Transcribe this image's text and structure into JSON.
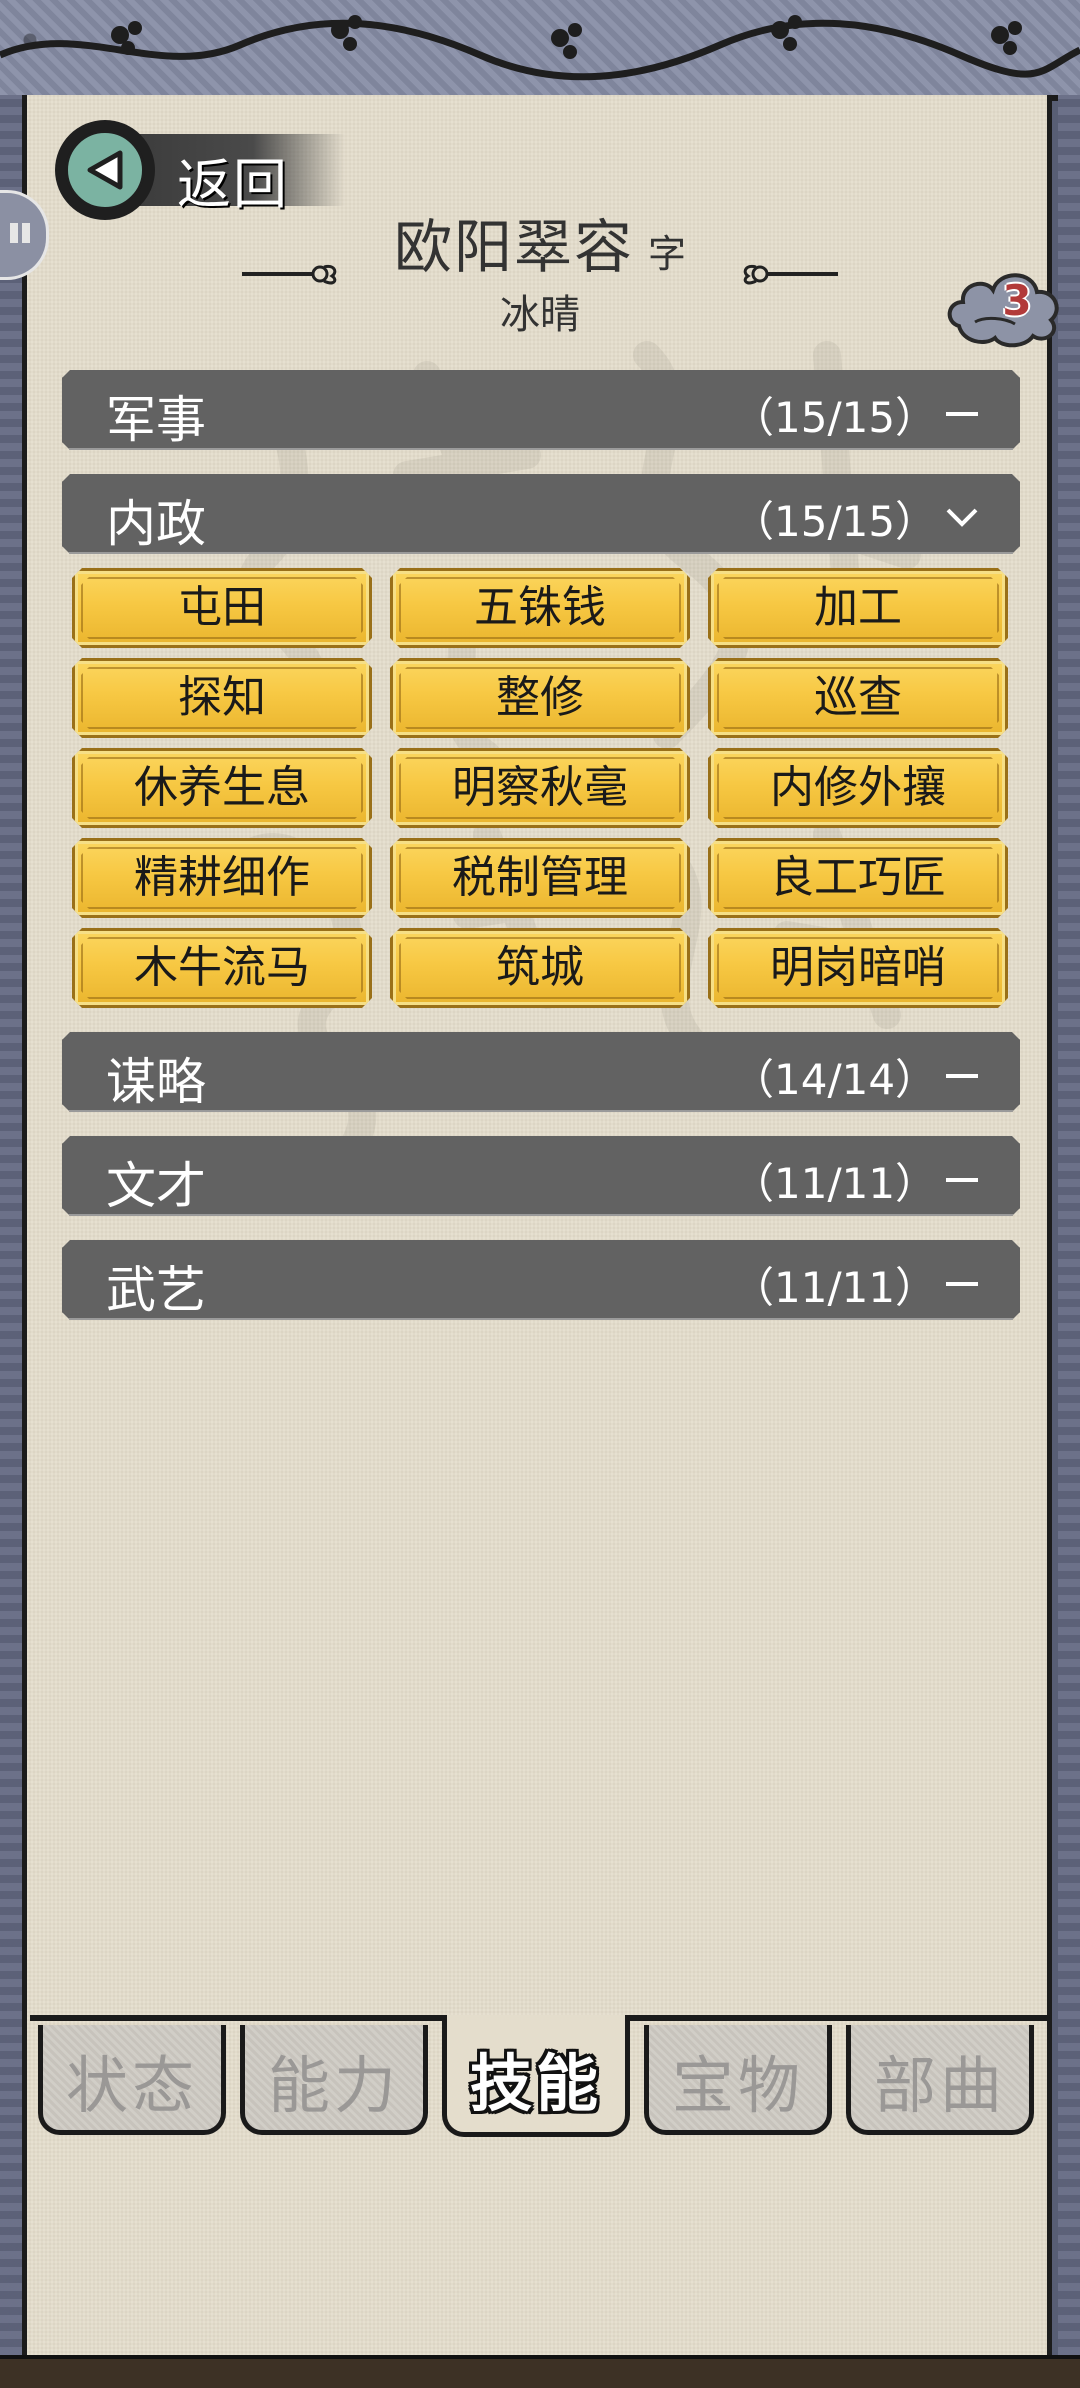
{
  "header": {
    "back_label": "返回",
    "hero_name": "欧阳翠容",
    "zi_label": "字",
    "courtesy_name": "冰晴",
    "badge_count": "3"
  },
  "categories": [
    {
      "name": "军事",
      "count": "（15/15）",
      "state": "collapsed"
    },
    {
      "name": "内政",
      "count": "（15/15）",
      "state": "expanded"
    },
    {
      "name": "谋略",
      "count": "（14/14）",
      "state": "collapsed"
    },
    {
      "name": "文才",
      "count": "（11/11）",
      "state": "collapsed"
    },
    {
      "name": "武艺",
      "count": "（11/11）",
      "state": "collapsed"
    }
  ],
  "neizheng_skills": [
    "屯田",
    "五铢钱",
    "加工",
    "探知",
    "整修",
    "巡查",
    "休养生息",
    "明察秋毫",
    "内修外攘",
    "精耕细作",
    "税制管理",
    "良工巧匠",
    "木牛流马",
    "筑城",
    "明岗暗哨"
  ],
  "tabs": [
    {
      "label": "状态",
      "active": false
    },
    {
      "label": "能力",
      "active": false
    },
    {
      "label": "技能",
      "active": true
    },
    {
      "label": "宝物",
      "active": false
    },
    {
      "label": "部曲",
      "active": false
    }
  ],
  "colors": {
    "category_bar": "#626262",
    "skill_button": "#f7c843",
    "paper": "#e4ddcc",
    "back_button": "#7bb3a2",
    "badge_number": "#b23a3a"
  },
  "icons": {
    "back": "play-left-icon",
    "collapsed": "dash-icon",
    "expanded": "chevron-down-icon",
    "badge": "cloud-icon"
  }
}
